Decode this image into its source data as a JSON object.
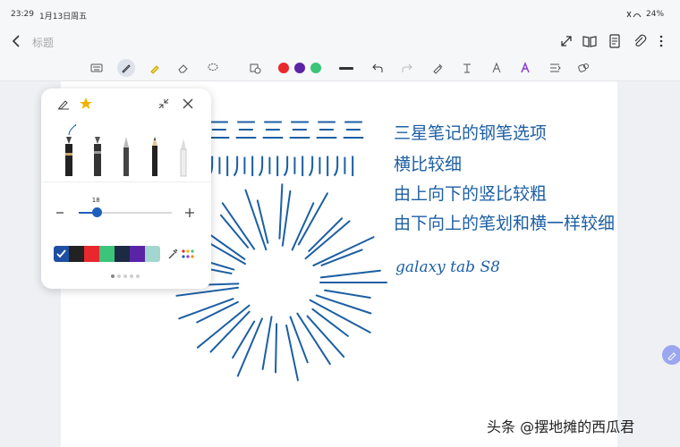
{
  "status": {
    "time": "23:29",
    "date": "1月13日周五",
    "battery": "24%"
  },
  "header": {
    "title": "标题"
  },
  "toolbar": {
    "colors": [
      "#e8282e",
      "#5b24a7",
      "#3cc47a"
    ],
    "icons": [
      "keyboard-icon",
      "pen-icon",
      "highlighter-icon",
      "eraser-icon",
      "lasso-icon",
      "shape-icon",
      "stroke-width-icon",
      "undo-icon",
      "redo-icon",
      "pen-settings-icon",
      "text-style-icon",
      "text-icon",
      "handwriting-icon",
      "text-box-icon",
      "more-icon"
    ]
  },
  "pen_panel": {
    "size_value": "18",
    "size_fraction": 0.2,
    "pens": [
      "fountain-pen",
      "calligraphy-pen",
      "ballpoint-pen",
      "pencil",
      "brush-pen"
    ],
    "palette": [
      "#1e4fa3",
      "#222222",
      "#e8282e",
      "#3cc47a",
      "#1c2a44",
      "#5b24a7",
      "#a3d6cf"
    ],
    "page_dots": 5
  },
  "note": {
    "lines": [
      "三星笔记的钢笔选项",
      "横比较细",
      "由上向下的竖比较粗",
      "由下向上的笔划和横一样较细",
      "galaxy tab S8"
    ],
    "repeat_a": "三三三三三三",
    "repeat_b": "川川川川川川"
  },
  "watermark": "头条 @摆地摊的西瓜君"
}
